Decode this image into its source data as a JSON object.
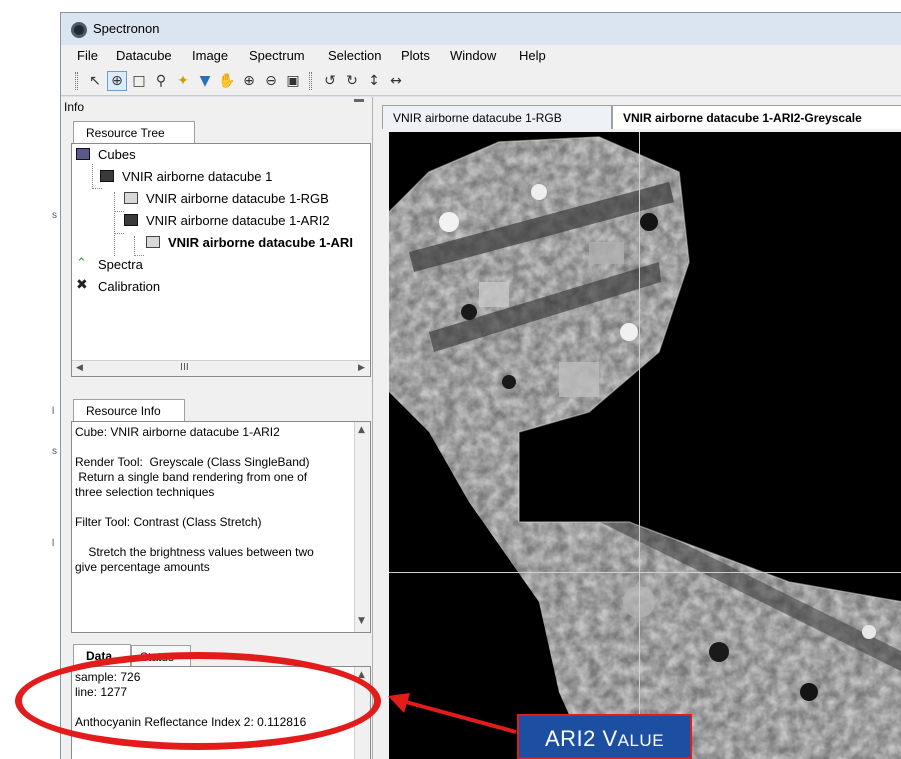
{
  "window": {
    "title": "Spectronon"
  },
  "menu": [
    "File",
    "Datacube",
    "Image",
    "Spectrum",
    "Selection",
    "Plots",
    "Window",
    "Help"
  ],
  "toolbar": {
    "icons": [
      "select-arrow-icon",
      "crosshair-icon",
      "rectangle-select-icon",
      "lasso-icon",
      "magic-wand-icon",
      "smart-select-icon",
      "pan-hand-icon",
      "zoom-in-icon",
      "zoom-out-icon",
      "zoom-fit-icon",
      "rotate-left-icon",
      "rotate-right-icon",
      "flip-vertical-icon",
      "flip-horizontal-icon"
    ]
  },
  "left_pane": {
    "title": "Info",
    "resource_tree_tab": "Resource Tree",
    "tree": [
      {
        "label": "Cubes",
        "icon": "cube-icon",
        "bold": false
      },
      {
        "label": "VNIR airborne datacube 1",
        "icon": "cube-icon",
        "bold": false
      },
      {
        "label": "VNIR airborne datacube 1-RGB",
        "icon": "image-icon",
        "bold": false
      },
      {
        "label": "VNIR airborne datacube 1-ARI2",
        "icon": "cube-icon",
        "bold": false
      },
      {
        "label": "VNIR airborne datacube 1-ARI",
        "icon": "image-icon",
        "bold": true
      },
      {
        "label": "Spectra",
        "icon": "spectra-icon",
        "bold": false
      },
      {
        "label": "Calibration",
        "icon": "calibration-icon",
        "bold": false
      }
    ],
    "scroll_grip": "III",
    "resource_info_tab": "Resource Info",
    "resource_info_text": "Cube: VNIR airborne datacube 1-ARI2\n\nRender Tool:  Greyscale (Class SingleBand)\n Return a single band rendering from one of\nthree selection techniques\n\nFilter Tool: Contrast (Class Stretch)\n\n    Stretch the brightness values between two\ngive percentage amounts",
    "data_tab": "Data",
    "status_tab": "Status",
    "data_text": "sample: 726\nline: 1277\n\nAnthocyanin Reflectance Index 2: 0.112816"
  },
  "right_pane": {
    "tabs": [
      {
        "label": "VNIR airborne datacube 1-RGB",
        "selected": false
      },
      {
        "label": "VNIR airborne datacube 1-ARI2-Greyscale",
        "selected": true
      }
    ]
  },
  "annotation": {
    "callout_main": "ARI2 V",
    "callout_small": "ALUE",
    "colors": {
      "ring": "#e21b1b",
      "box": "#1c4ea1"
    }
  }
}
